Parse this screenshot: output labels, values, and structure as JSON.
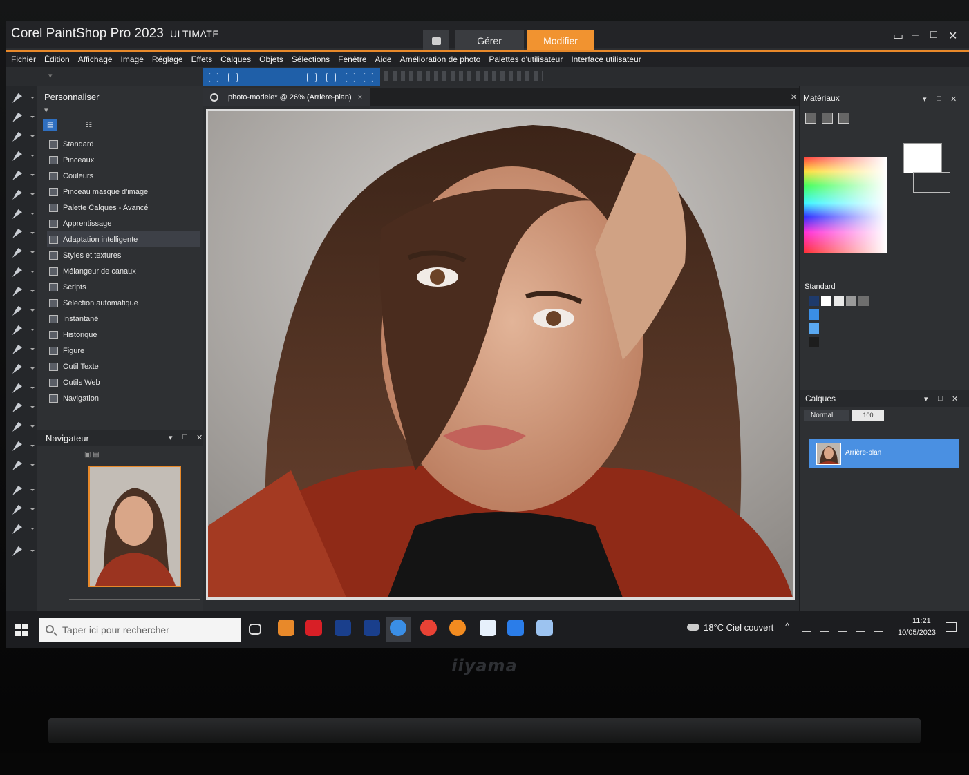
{
  "window": {
    "title": "Corel PaintShop Pro 2023",
    "edition": "ULTIMATE",
    "tabs": {
      "manage": "Gérer",
      "edit": "Modifier"
    },
    "controls": {
      "minimize": "–",
      "maximize": "□",
      "close": "✕"
    }
  },
  "menu": [
    "Fichier",
    "Édition",
    "Affichage",
    "Image",
    "Réglage",
    "Effets",
    "Calques",
    "Objets",
    "Sélections",
    "Fenêtre",
    "Aide",
    "Amélioration de photo",
    "Palettes d'utilisateur",
    "Interface utilisateur"
  ],
  "personnaliser": {
    "title": "Personnaliser",
    "items": [
      "Standard",
      "Pinceaux",
      "Couleurs",
      "Pinceau masque d'image",
      "Palette Calques - Avancé",
      "Apprentissage",
      "Adaptation intelligente",
      "Styles et textures",
      "Mélangeur de canaux",
      "Scripts",
      "Sélection automatique",
      "Instantané",
      "Historique",
      "Figure",
      "Outil Texte",
      "Outils Web",
      "Navigation"
    ],
    "selected_index": 6
  },
  "navigator": {
    "title": "Navigateur"
  },
  "document": {
    "tab_label": "photo-modele* @ 26% (Arrière-plan)"
  },
  "materials": {
    "title": "Matériaux",
    "standard_label": "Standard"
  },
  "layers": {
    "title": "Calques",
    "blend_mode": "Normal",
    "opacity": "100",
    "layer_name": "Arrière-plan"
  },
  "taskbar": {
    "search_placeholder": "Taper ici pour rechercher",
    "weather": "18°C Ciel couvert",
    "time": "11:21",
    "date": "10/05/2023"
  },
  "brand": "iiyama",
  "colors": {
    "accent": "#f19330",
    "selection": "#4a90e2",
    "toolbar_active": "#1f5fa8"
  }
}
